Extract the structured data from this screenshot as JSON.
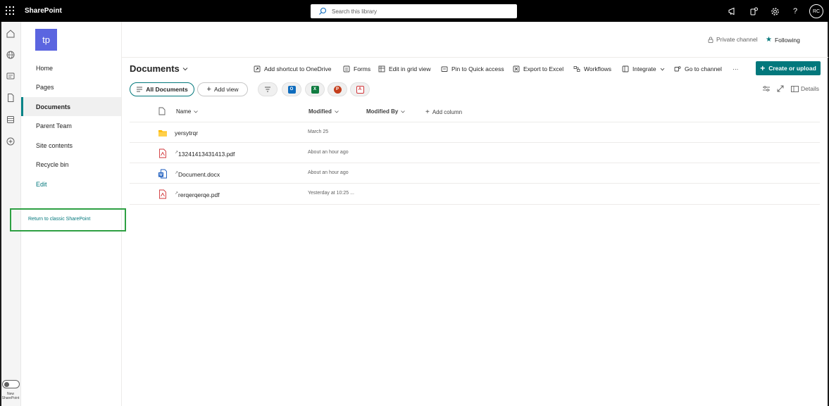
{
  "topbar": {
    "app_name": "SharePoint",
    "search_placeholder": "Search this library",
    "help_label": "?",
    "avatar_initials": "RC"
  },
  "rail": {
    "toggle_label": "New SharePoint"
  },
  "site": {
    "logo_initials": "tp",
    "private_label": "Private channel",
    "following_label": "Following"
  },
  "nav": {
    "items": [
      {
        "label": "Home"
      },
      {
        "label": "Pages"
      },
      {
        "label": "Documents"
      },
      {
        "label": "Parent Team"
      },
      {
        "label": "Site contents"
      },
      {
        "label": "Recycle bin"
      },
      {
        "label": "Edit"
      }
    ],
    "classic_link": "Return to classic SharePoint"
  },
  "library": {
    "title": "Documents",
    "commands": {
      "shortcut": "Add shortcut to OneDrive",
      "forms": "Forms",
      "grid": "Edit in grid view",
      "pin": "Pin to Quick access",
      "export": "Export to Excel",
      "workflows": "Workflows",
      "integrate": "Integrate",
      "channel": "Go to channel",
      "more": "···",
      "create": "Create or upload"
    },
    "views": {
      "all_documents": "All Documents",
      "add_view": "Add view",
      "details": "Details"
    },
    "app_icons": [
      {
        "name": "outlook",
        "letter": "O",
        "color": "#0f6cbd"
      },
      {
        "name": "excel",
        "letter": "X",
        "color": "#107c41"
      },
      {
        "name": "powerpoint",
        "letter": "P",
        "color": "#c43e1c"
      },
      {
        "name": "pdf",
        "letter": "A",
        "color": "#d13438"
      }
    ]
  },
  "table": {
    "columns": {
      "name": "Name",
      "modified": "Modified",
      "modified_by": "Modified By",
      "add_column": "Add column"
    },
    "rows": [
      {
        "type": "folder",
        "name": "yersytrqr",
        "modified": "March 25"
      },
      {
        "type": "pdf",
        "name": "13241413431413.pdf",
        "modified": "About an hour ago"
      },
      {
        "type": "docx",
        "name": "Document.docx",
        "modified": "About an hour ago"
      },
      {
        "type": "pdf",
        "name": "rerqerqerqe.pdf",
        "modified": "Yesterday at 10:25 ..."
      }
    ]
  },
  "colors": {
    "accent": "#03787c",
    "logo": "#5b65e0",
    "highlight": "#2ea043"
  }
}
